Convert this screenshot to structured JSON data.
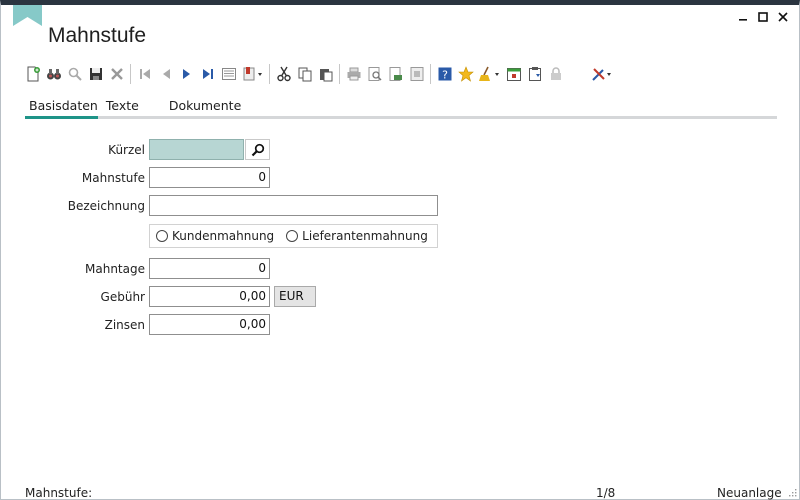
{
  "window": {
    "title": "Mahnstufe",
    "controls": [
      "—",
      "□",
      "✕"
    ],
    "accent": "#1e9488",
    "bookmark_color": "#7fc6c6"
  },
  "toolbar": {
    "groups": [
      [
        "new-document-icon",
        "binoculars-icon",
        "magnifier-icon",
        "save-icon",
        "delete-icon"
      ],
      [
        "first-record-icon",
        "previous-record-icon",
        "next-record-icon",
        "last-record-icon",
        "list-view-icon",
        "print-menu-icon"
      ],
      [
        "cut-icon",
        "copy-icon",
        "paste-icon"
      ],
      [
        "printer-icon",
        "print-preview-icon",
        "export-icon",
        "zoom-page-icon"
      ],
      [
        "help-icon",
        "favorite-star-icon",
        "broom-icon",
        "calendar-icon",
        "clipboard-icon",
        "lock-icon"
      ],
      [
        "tools-icon"
      ]
    ]
  },
  "tabs": [
    {
      "label": "Basisdaten",
      "active": true
    },
    {
      "label": "Texte",
      "active": false
    },
    {
      "label": "Dokumente",
      "active": false
    }
  ],
  "form": {
    "kuerzel": {
      "label": "Kürzel",
      "value": ""
    },
    "mahnstufe": {
      "label": "Mahnstufe",
      "value": "0"
    },
    "bezeichnung": {
      "label": "Bezeichnung",
      "value": ""
    },
    "radios": {
      "kunden": "Kundenmahnung",
      "lieferanten": "Lieferantenmahnung"
    },
    "mahntage": {
      "label": "Mahntage",
      "value": "0"
    },
    "gebuehr": {
      "label": "Gebühr",
      "value": "0,00",
      "currency": "EUR"
    },
    "zinsen": {
      "label": "Zinsen",
      "value": "0,00"
    }
  },
  "status": {
    "left": "Mahnstufe:",
    "record": "1/8",
    "mode": "Neuanlage"
  }
}
